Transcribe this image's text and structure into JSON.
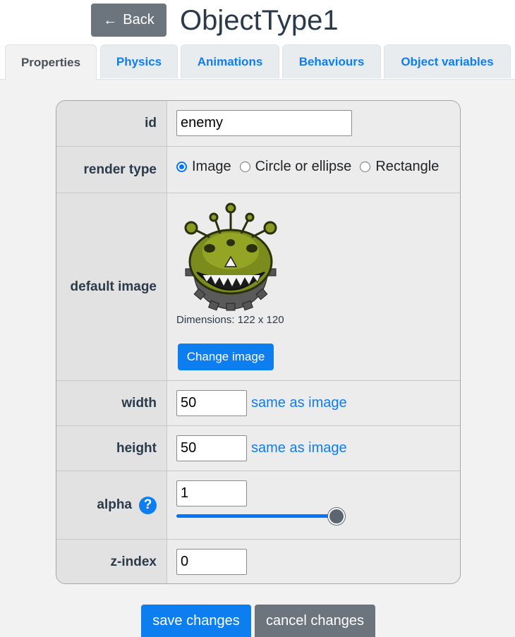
{
  "header": {
    "back_label": "Back",
    "back_icon": "arrow-left-icon",
    "title": "ObjectType1"
  },
  "tabs": [
    {
      "label": "Properties",
      "active": true
    },
    {
      "label": "Physics",
      "active": false
    },
    {
      "label": "Animations",
      "active": false
    },
    {
      "label": "Behaviours",
      "active": false
    },
    {
      "label": "Object variables",
      "active": false
    }
  ],
  "form": {
    "id": {
      "label": "id",
      "value": "enemy"
    },
    "render_type": {
      "label": "render type",
      "options": [
        "Image",
        "Circle or ellipse",
        "Rectangle"
      ],
      "selected": "Image"
    },
    "default_image": {
      "label": "default image",
      "dimensions_text": "Dimensions: 122 x 120",
      "change_label": "Change image"
    },
    "width": {
      "label": "width",
      "value": "50",
      "link": "same as image"
    },
    "height": {
      "label": "height",
      "value": "50",
      "link": "same as image"
    },
    "alpha": {
      "label": "alpha",
      "help_icon": "?",
      "value": "1",
      "slider_value": 1.0
    },
    "z_index": {
      "label": "z-index",
      "value": "0"
    }
  },
  "actions": {
    "save_label": "save changes",
    "cancel_label": "cancel changes"
  },
  "colors": {
    "primary": "#0d7ef0",
    "secondary": "#6c757d",
    "title": "#2b3a4a"
  }
}
